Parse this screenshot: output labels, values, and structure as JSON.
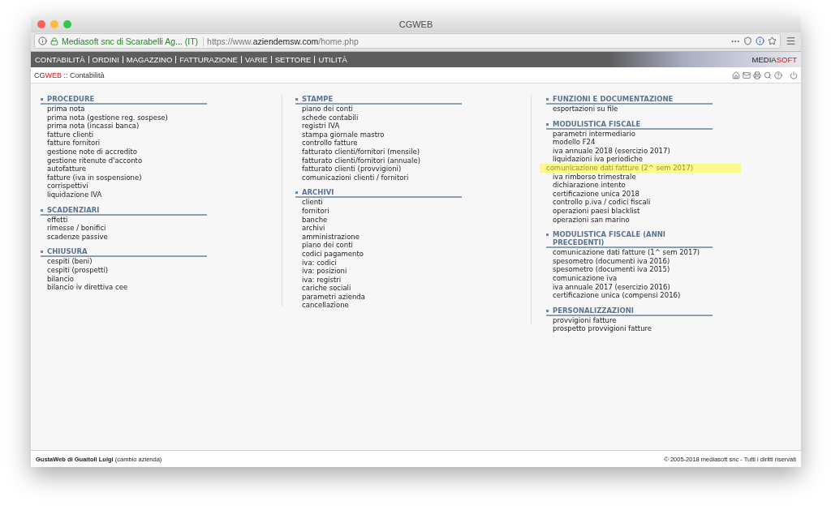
{
  "window": {
    "title": "CGWEB"
  },
  "address_bar": {
    "site_identity": "Mediasoft snc di Scarabelli Ag... (IT)",
    "url_prefix": "https://www.",
    "url_domain": "aziendemsw.com",
    "url_path": "/home.php"
  },
  "nav": {
    "items": [
      "CONTABILITÀ",
      "ORDINI",
      "MAGAZZINO",
      "FATTURAZIONE",
      "VARIE",
      "SETTORE",
      "UTILITÀ"
    ],
    "brand_first": "MEDIA",
    "brand_second": "SOFT"
  },
  "breadcrumb": {
    "app_first": "CG",
    "app_second": "WEB",
    "separator": "::",
    "page": "Contabilità"
  },
  "columns": [
    {
      "sections": [
        {
          "title": "PROCEDURE",
          "items": [
            {
              "label": "prima nota",
              "highlighted": false
            },
            {
              "label": "prima nota (gestione reg. sospese)",
              "highlighted": false
            },
            {
              "label": "prima nota (incassi banca)",
              "highlighted": false
            },
            {
              "label": "fatture clienti",
              "highlighted": false
            },
            {
              "label": "fatture fornitori",
              "highlighted": false
            },
            {
              "label": "gestione note di accredito",
              "highlighted": false
            },
            {
              "label": "gestione ritenute d'acconto",
              "highlighted": false
            },
            {
              "label": "autofatture",
              "highlighted": false
            },
            {
              "label": "fatture (iva in sospensione)",
              "highlighted": false
            },
            {
              "label": "corrispettivi",
              "highlighted": false
            },
            {
              "label": "liquidazione IVA",
              "highlighted": false
            }
          ]
        },
        {
          "title": "SCADENZIARI",
          "items": [
            {
              "label": "effetti",
              "highlighted": false
            },
            {
              "label": "rimesse / bonifici",
              "highlighted": false
            },
            {
              "label": "scadenze passive",
              "highlighted": false
            }
          ]
        },
        {
          "title": "CHIUSURA",
          "items": [
            {
              "label": "cespiti (beni)",
              "highlighted": false
            },
            {
              "label": "cespiti (prospetti)",
              "highlighted": false
            },
            {
              "label": "bilancio",
              "highlighted": false
            },
            {
              "label": "bilancio iv direttiva cee",
              "highlighted": false
            }
          ]
        }
      ]
    },
    {
      "sections": [
        {
          "title": "STAMPE",
          "items": [
            {
              "label": "piano dei conti",
              "highlighted": false
            },
            {
              "label": "schede contabili",
              "highlighted": false
            },
            {
              "label": "registri IVA",
              "highlighted": false
            },
            {
              "label": "stampa giornale mastro",
              "highlighted": false
            },
            {
              "label": "controllo fatture",
              "highlighted": false
            },
            {
              "label": "fatturato clienti/fornitori (mensile)",
              "highlighted": false
            },
            {
              "label": "fatturato clienti/fornitori (annuale)",
              "highlighted": false
            },
            {
              "label": "fatturato clienti (provvigioni)",
              "highlighted": false
            },
            {
              "label": "comunicazioni clienti / fornitori",
              "highlighted": false
            }
          ]
        },
        {
          "title": "ARCHIVI",
          "items": [
            {
              "label": "clienti",
              "highlighted": false
            },
            {
              "label": "fornitori",
              "highlighted": false
            },
            {
              "label": "banche",
              "highlighted": false
            },
            {
              "label": "archivi",
              "highlighted": false
            },
            {
              "label": "amministrazione",
              "highlighted": false
            },
            {
              "label": "piano dei conti",
              "highlighted": false
            },
            {
              "label": "codici pagamento",
              "highlighted": false
            },
            {
              "label": "iva: codici",
              "highlighted": false
            },
            {
              "label": "iva: posizioni",
              "highlighted": false
            },
            {
              "label": "iva: registri",
              "highlighted": false
            },
            {
              "label": "cariche sociali",
              "highlighted": false
            },
            {
              "label": "parametri azienda",
              "highlighted": false
            },
            {
              "label": "cancellazione",
              "highlighted": false
            }
          ]
        }
      ]
    },
    {
      "sections": [
        {
          "title": "FUNZIONI E DOCUMENTAZIONE",
          "items": [
            {
              "label": "esportazioni su file",
              "highlighted": false
            }
          ]
        },
        {
          "title": "MODULISTICA FISCALE",
          "items": [
            {
              "label": "parametri intermediario",
              "highlighted": false
            },
            {
              "label": "modello F24",
              "highlighted": false
            },
            {
              "label": "iva annuale 2018 (esercizio 2017)",
              "highlighted": false
            },
            {
              "label": "liquidazioni iva periodiche",
              "highlighted": false
            },
            {
              "label": "comunicazione dati fatture (2^ sem 2017)",
              "highlighted": true
            },
            {
              "label": "iva rimborso trimestrale",
              "highlighted": false
            },
            {
              "label": "dichiarazione intento",
              "highlighted": false
            },
            {
              "label": "certificazione unica 2018",
              "highlighted": false
            },
            {
              "label": "controllo p.iva / codici fiscali",
              "highlighted": false
            },
            {
              "label": "operazioni paesi blacklist",
              "highlighted": false
            },
            {
              "label": "operazioni san marino",
              "highlighted": false
            }
          ]
        },
        {
          "title": "MODULISTICA FISCALE (ANNI PRECEDENTI)",
          "items": [
            {
              "label": "comunicazione dati fatture (1^ sem 2017)",
              "highlighted": false
            },
            {
              "label": "spesometro (documenti iva 2016)",
              "highlighted": false
            },
            {
              "label": "spesometro (documenti iva 2015)",
              "highlighted": false
            },
            {
              "label": "comunicazione iva",
              "highlighted": false
            },
            {
              "label": "iva annuale 2017 (esercizio 2016)",
              "highlighted": false
            },
            {
              "label": "certificazione unica (compensi 2016)",
              "highlighted": false
            }
          ]
        },
        {
          "title": "PERSONALIZZAZIONI",
          "items": [
            {
              "label": "provvigioni fatture",
              "highlighted": false
            },
            {
              "label": "prospetto provvigioni fatture",
              "highlighted": false
            }
          ]
        }
      ]
    }
  ],
  "footer": {
    "company": "GustaWeb di Guaitoli Luigi",
    "change_link": "(cambio azienda)",
    "copyright": "© 2005-2018 mediasoft snc - Tutti i diritti riservati"
  }
}
